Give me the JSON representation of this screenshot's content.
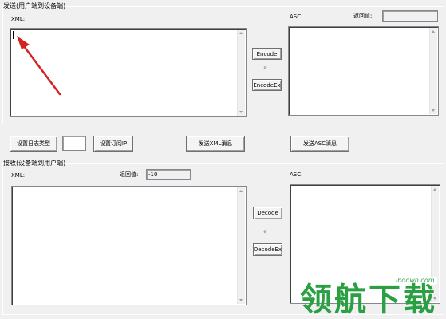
{
  "send_group": {
    "legend": "发送(用户端到设备端)",
    "xml_label": "XML:",
    "asc_label": "ASC:",
    "return_label": "返回值:",
    "return_value": "",
    "encode_label": "Encode",
    "arrows": "»",
    "encodeex_label": "EncodeEx"
  },
  "middle_bar": {
    "set_log_type": "设置日志类型",
    "log_type_value": "",
    "set_subscribe_ip": "设置订阅IP",
    "send_xml": "发送XML消息",
    "send_asc": "发送ASC消息"
  },
  "receive_group": {
    "legend": "接收(设备端到用户端)",
    "xml_label": "XML:",
    "return_label": "返回值:",
    "return_value": "-10",
    "asc_label": "ASC:",
    "decode_label": "Decode",
    "arrows": "«",
    "decodeex_label": "DecodeEx"
  },
  "watermark": {
    "text": "领航下载",
    "site": "lhdown.com"
  },
  "colors": {
    "annotation_arrow": "#d22222",
    "watermark": "#2aa043"
  }
}
